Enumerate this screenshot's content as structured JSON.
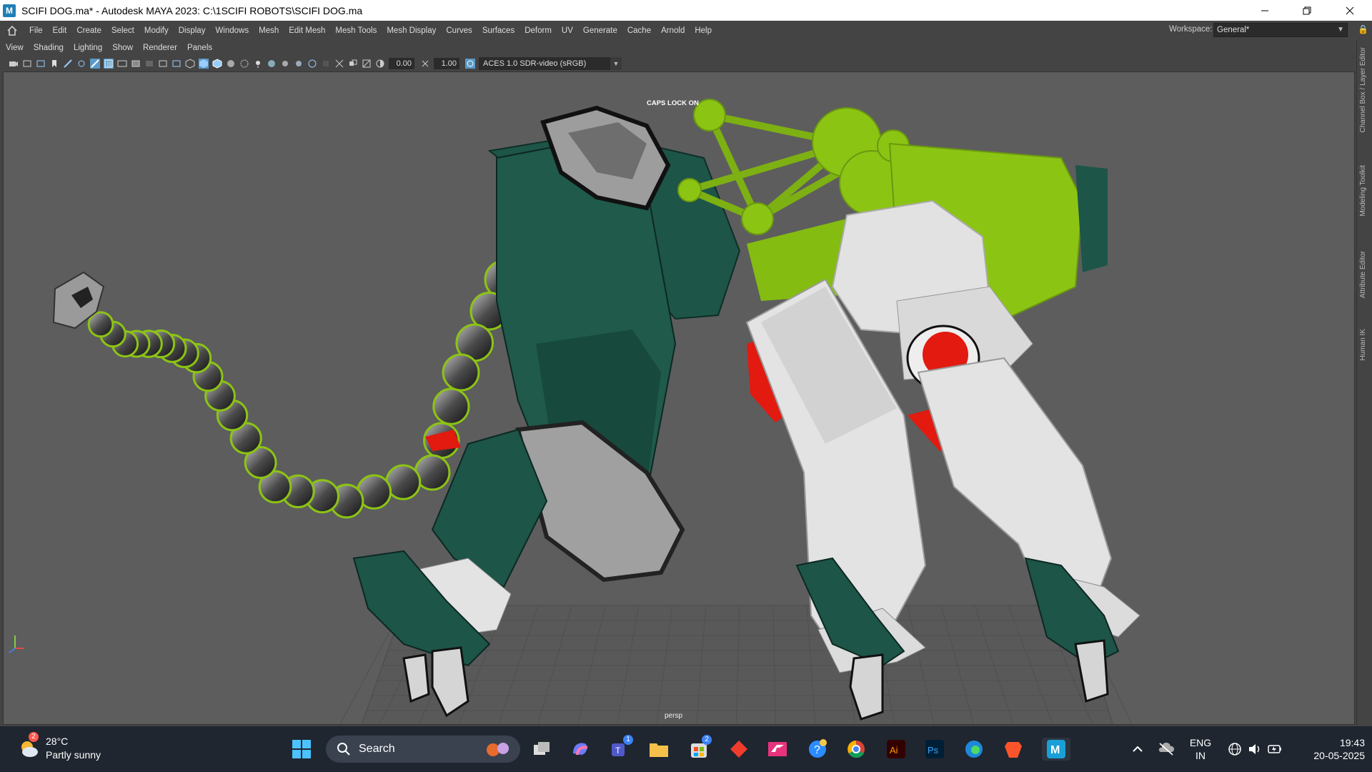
{
  "window": {
    "title": "SCIFI DOG.ma* - Autodesk MAYA 2023: C:\\1SCIFI ROBOTS\\SCIFI DOG.ma",
    "app_icon_letter": "M"
  },
  "main_menu": {
    "items": [
      "File",
      "Edit",
      "Create",
      "Select",
      "Modify",
      "Display",
      "Windows",
      "Mesh",
      "Edit Mesh",
      "Mesh Tools",
      "Mesh Display",
      "Curves",
      "Surfaces",
      "Deform",
      "UV",
      "Generate",
      "Cache",
      "Arnold",
      "Help"
    ],
    "workspace_label": "Workspace:",
    "workspace_value": "General*"
  },
  "panel_menu": {
    "items": [
      "View",
      "Shading",
      "Lighting",
      "Show",
      "Renderer",
      "Panels"
    ]
  },
  "panel_toolbar": {
    "exposure": "0.00",
    "gamma": "1.00",
    "color_space": "ACES 1.0 SDR-video (sRGB)"
  },
  "viewport": {
    "caps_lock_text": "CAPS LOCK ON",
    "camera_name": "persp"
  },
  "side_tabs": [
    "Channel Box / Layer Editor",
    "Modeling Toolkit",
    "Attribute Editor",
    "Human IK"
  ],
  "taskbar": {
    "weather_temp": "28°C",
    "weather_condition": "Partly sunny",
    "weather_badge": "2",
    "search_label": "Search",
    "teams_badge": "1",
    "store_badge": "2",
    "language_primary": "ENG",
    "language_secondary": "IN",
    "time": "19:43",
    "date": "20-05-2025"
  },
  "colors": {
    "model_dark_green": "#1d5548",
    "model_lime": "#8cc414",
    "model_white": "#e2e2e2",
    "model_red": "#e21a10",
    "viewport_bg": "#5d5d5d"
  }
}
